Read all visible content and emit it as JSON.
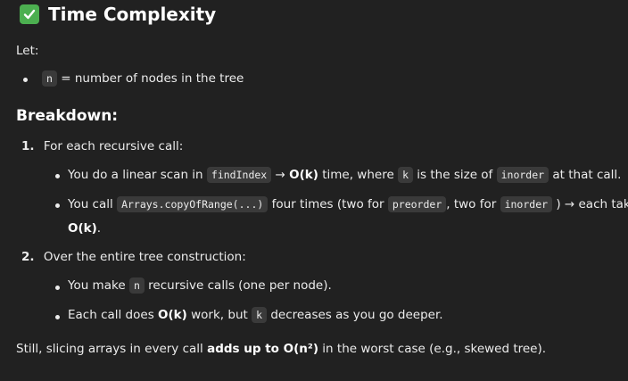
{
  "heading": {
    "title": "Time Complexity",
    "icon": "check-box-icon",
    "icon_color": "#4caf50"
  },
  "intro": {
    "let": "Let:"
  },
  "let_item": {
    "code": "n",
    "text": "= number of nodes in the tree"
  },
  "breakdown": {
    "title": "Breakdown:"
  },
  "step1": {
    "number": "1.",
    "title": "For each recursive call:",
    "bullet1": {
      "t1": "You do a linear scan in",
      "c1": "findIndex",
      "t2": "→",
      "b1": "O(k)",
      "t3": "time, where",
      "c2": "k",
      "t4": "is the size of",
      "c3": "inorder",
      "t5": "at that call."
    },
    "bullet2": {
      "t1": "You call",
      "c1": "Arrays.copyOfRange(...)",
      "t2": "four times (two for",
      "c2": "preorder",
      "t3": ", two for",
      "c3": "inorder",
      "t4": ") → each takes",
      "b1": "O(k)",
      "t5": "."
    }
  },
  "step2": {
    "number": "2.",
    "title": "Over the entire tree construction:",
    "bullet1": {
      "t1": "You make",
      "c1": "n",
      "t2": "recursive calls (one per node)."
    },
    "bullet2": {
      "t1": "Each call does",
      "b1": "O(k)",
      "t2": "work, but",
      "c1": "k",
      "t3": "decreases as you go deeper."
    }
  },
  "conclusion": {
    "t1": "Still, slicing arrays in every call",
    "b1": "adds up to O(n²)",
    "t2": "in the worst case (e.g., skewed tree)."
  }
}
